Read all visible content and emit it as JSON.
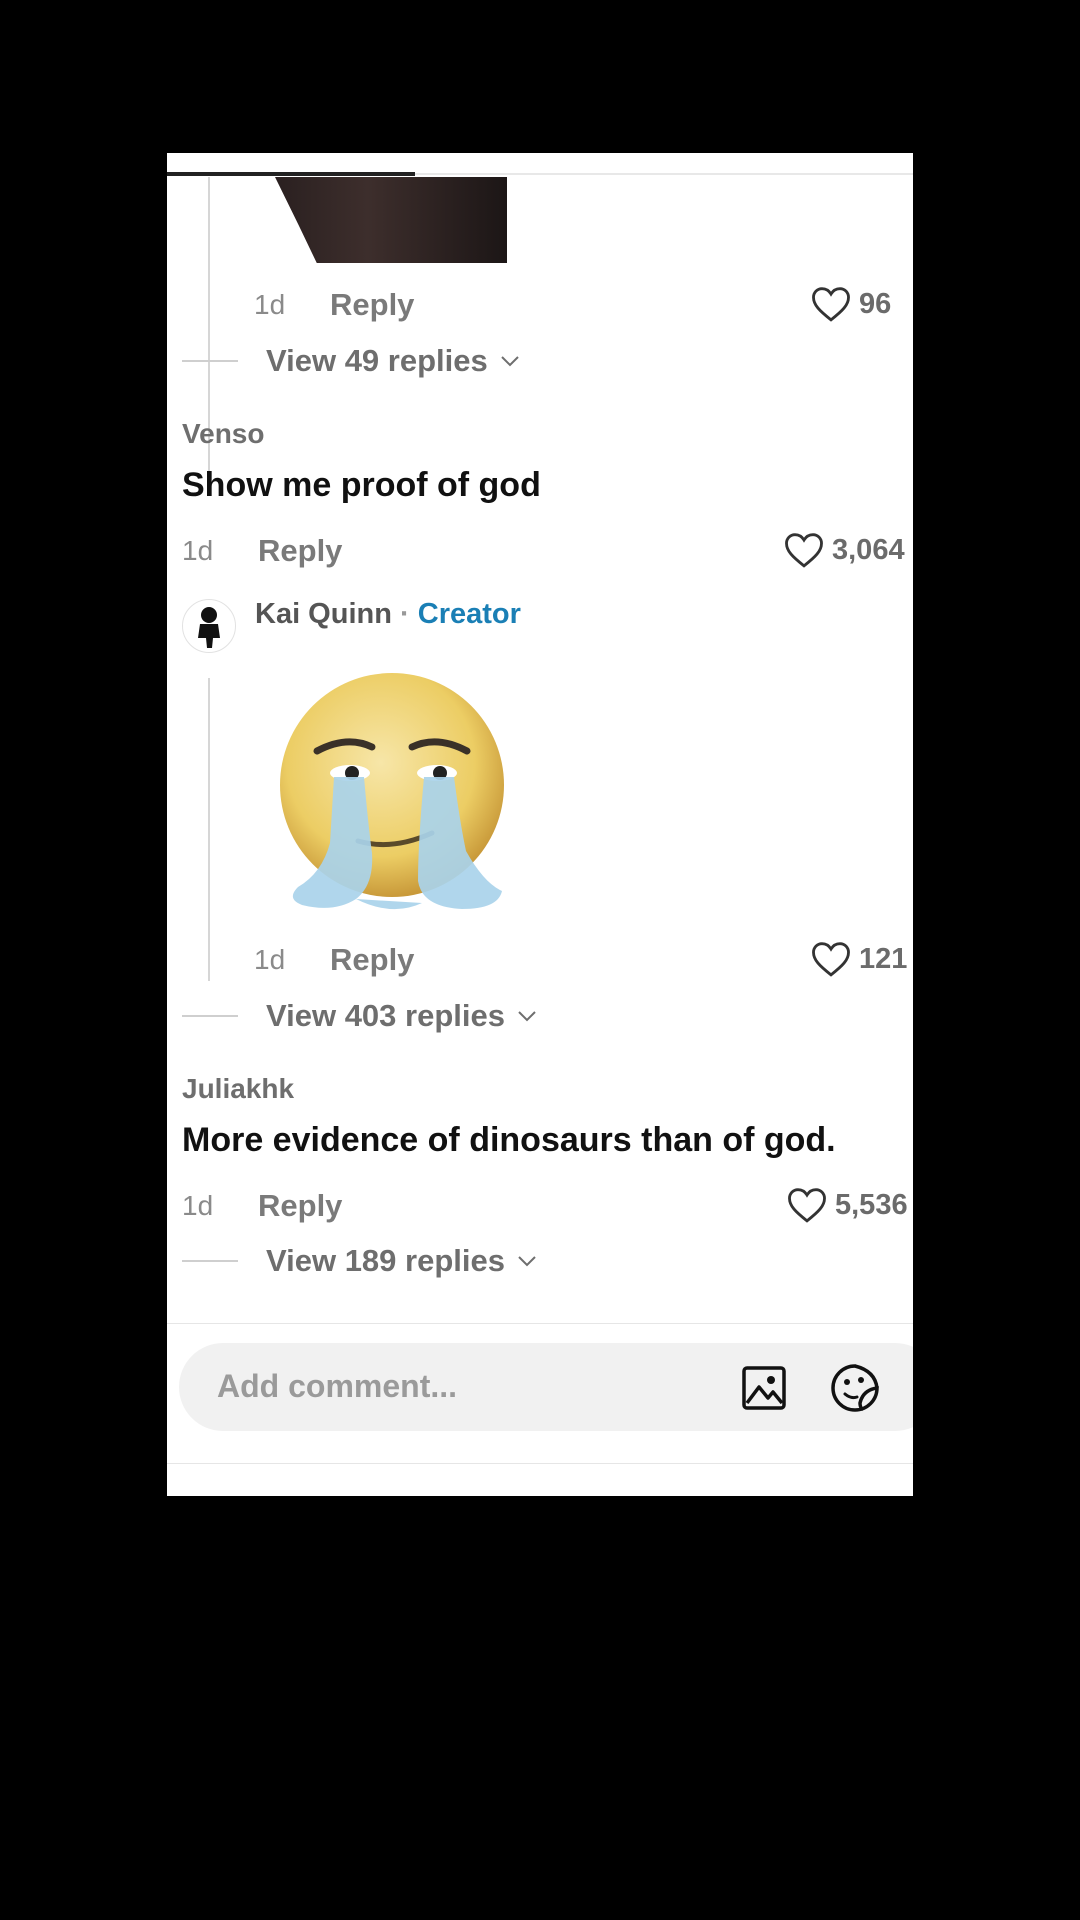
{
  "comments": [
    {
      "time": "1d",
      "reply_label": "Reply",
      "likes": "96",
      "view_replies": "View 49 replies"
    },
    {
      "username": "Venso",
      "text": "Show me proof of god",
      "time": "1d",
      "reply_label": "Reply",
      "likes": "3,064"
    },
    {
      "username": "Kai Quinn",
      "separator": "·",
      "badge": "Creator",
      "time": "1d",
      "reply_label": "Reply",
      "likes": "121",
      "view_replies": "View 403 replies"
    },
    {
      "username": "Juliakhk",
      "text": "More evidence of dinosaurs than of god.",
      "time": "1d",
      "reply_label": "Reply",
      "likes": "5,536",
      "view_replies": "View 189 replies"
    }
  ],
  "composer": {
    "placeholder": "Add comment...",
    "image_icon": "image-icon",
    "emoji_icon": "emoji-sticker-icon"
  },
  "colors": {
    "creator_badge": "#1a7fb5",
    "background": "#000000",
    "panel": "#ffffff"
  }
}
